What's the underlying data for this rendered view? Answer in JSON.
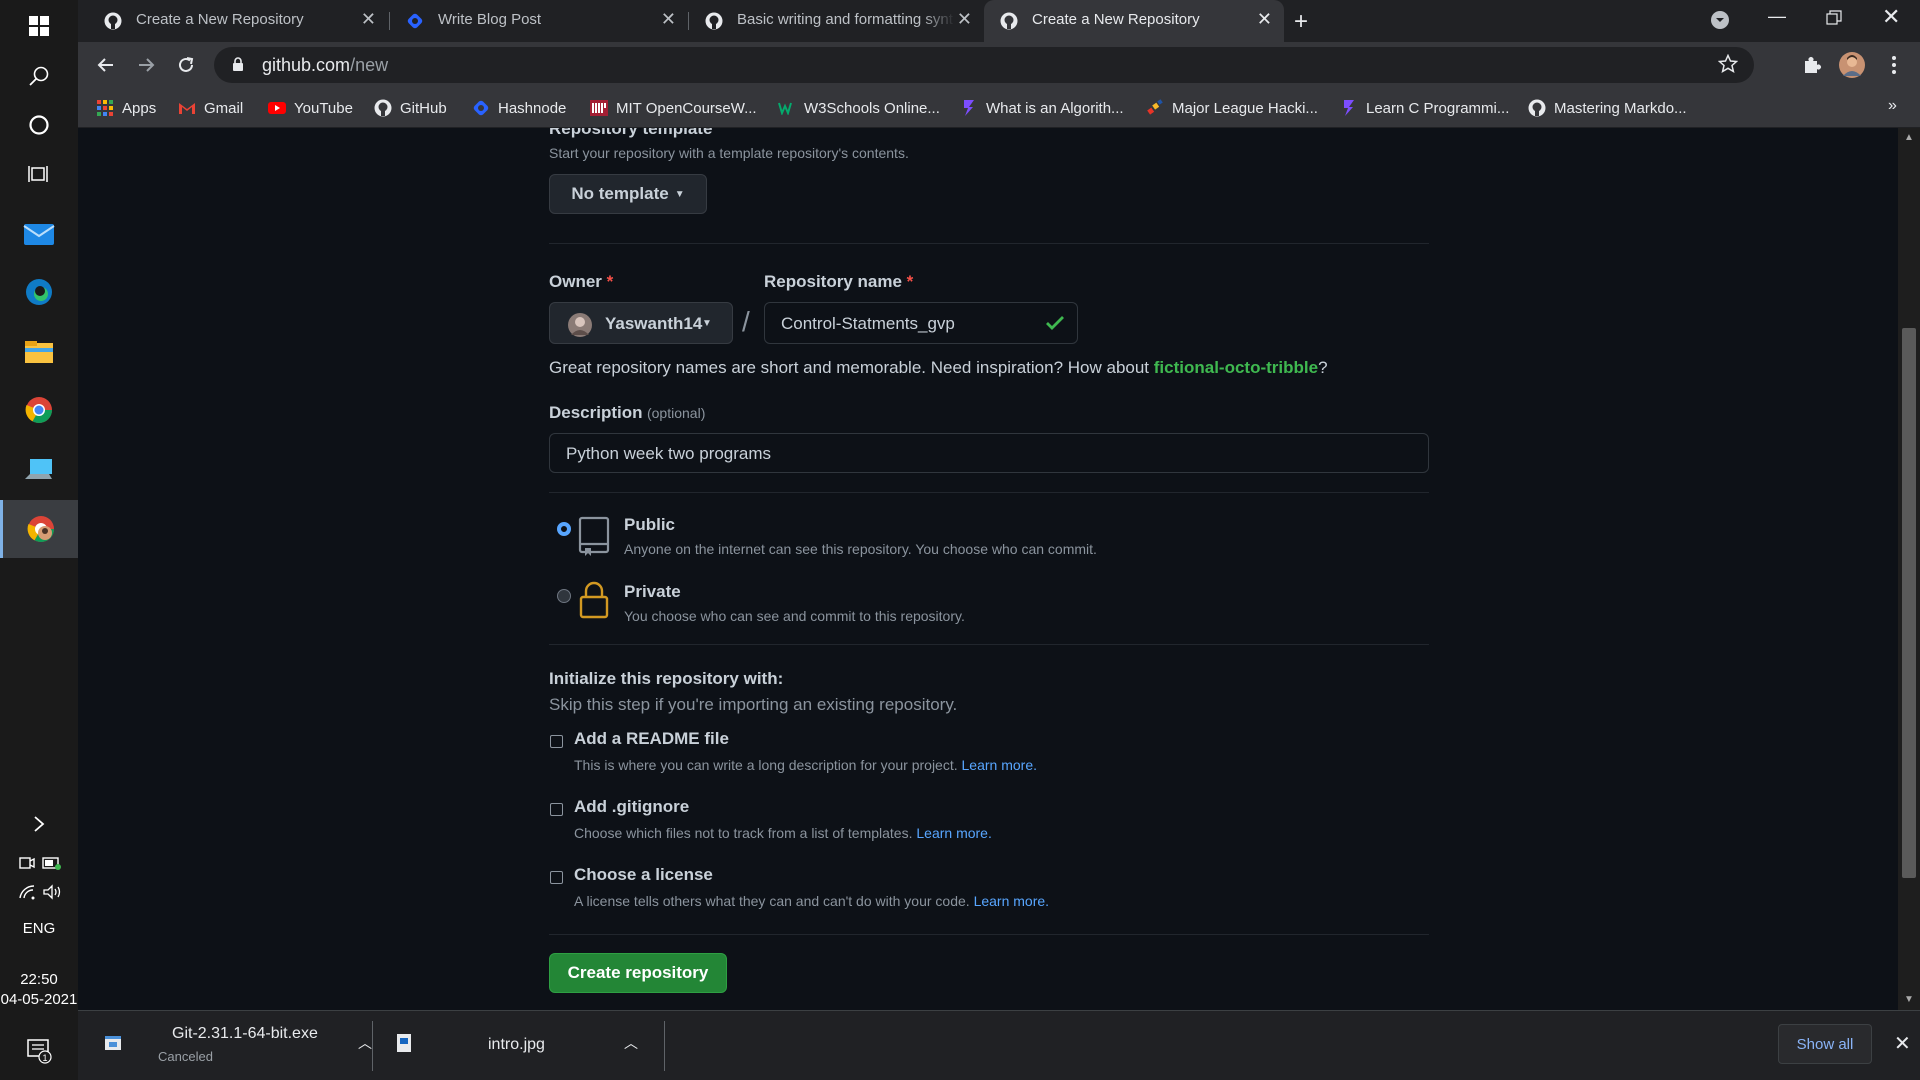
{
  "taskbar": {
    "time": "22:50",
    "date": "04-05-2021",
    "language": "ENG",
    "notification_count": "1"
  },
  "browser": {
    "tabs": [
      {
        "label": "Create a New Repository",
        "icon": "github-icon",
        "active": false
      },
      {
        "label": "Write Blog Post",
        "icon": "hashnode-icon",
        "active": false
      },
      {
        "label": "Basic writing and formatting synt",
        "icon": "github-icon",
        "active": false
      },
      {
        "label": "Create a New Repository",
        "icon": "github-icon",
        "active": true
      }
    ],
    "url_host": "github.com",
    "url_path": "/new",
    "bookmarks": [
      {
        "label": "Apps",
        "icon": "apps-grid-icon"
      },
      {
        "label": "Gmail",
        "icon": "gmail-icon"
      },
      {
        "label": "YouTube",
        "icon": "youtube-icon"
      },
      {
        "label": "GitHub",
        "icon": "github-icon"
      },
      {
        "label": "Hashnode",
        "icon": "hashnode-icon"
      },
      {
        "label": "MIT OpenCourseW...",
        "icon": "mit-icon"
      },
      {
        "label": "W3Schools Online...",
        "icon": "w3schools-icon"
      },
      {
        "label": "What is an Algorith...",
        "icon": "bookmark-icon"
      },
      {
        "label": "Major League Hacki...",
        "icon": "mlh-icon"
      },
      {
        "label": "Learn C Programmi...",
        "icon": "bookmark-icon"
      },
      {
        "label": "Mastering Markdo...",
        "icon": "github-icon"
      }
    ]
  },
  "form": {
    "template_heading": "Repository template",
    "template_help": "Start your repository with a template repository's contents.",
    "template_button": "No template",
    "owner_label": "Owner",
    "required_mark": "*",
    "owner_value": "Yaswanth14",
    "slash": "/",
    "repo_name_label": "Repository name",
    "repo_name_value": "Control-Statments_gvp",
    "name_hint_prefix": "Great repository names are short and memorable. Need inspiration? How about ",
    "name_hint_suggestion": "fictional-octo-tribble",
    "name_hint_suffix": "?",
    "description_label": "Description",
    "description_optional": "(optional)",
    "description_value": "Python week two programs",
    "visibility": [
      {
        "title": "Public",
        "desc": "Anyone on the internet can see this repository. You choose who can commit.",
        "selected": true
      },
      {
        "title": "Private",
        "desc": "You choose who can see and commit to this repository.",
        "selected": false
      }
    ],
    "init_heading": "Initialize this repository with:",
    "init_help": "Skip this step if you're importing an existing repository.",
    "init_options": [
      {
        "title": "Add a README file",
        "desc": "This is where you can write a long description for your project.",
        "link": "Learn more.",
        "checked": false
      },
      {
        "title": "Add .gitignore",
        "desc": "Choose which files not to track from a list of templates.",
        "link": "Learn more.",
        "checked": false
      },
      {
        "title": "Choose a license",
        "desc": "A license tells others what they can and can't do with your code.",
        "link": "Learn more.",
        "checked": false
      }
    ],
    "submit_button": "Create repository"
  },
  "downloads": {
    "items": [
      {
        "name": "Git-2.31.1-64-bit.exe",
        "status": "Canceled"
      },
      {
        "name": "intro.jpg",
        "status": ""
      }
    ],
    "show_all": "Show all"
  },
  "colors": {
    "accent_green": "#238636",
    "link_blue": "#58a6ff",
    "suggestion_green": "#3fb950",
    "required_red": "#f85149"
  }
}
